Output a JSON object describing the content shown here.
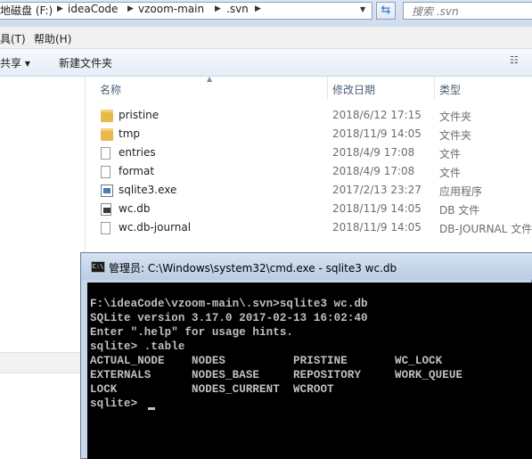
{
  "address_bar": {
    "crumbs": [
      "地磁盘 (F:)",
      "ideaCode",
      "vzoom-main",
      ".svn"
    ],
    "search_placeholder": "搜索 .svn"
  },
  "menu": {
    "items": [
      "具(T)",
      "帮助(H)"
    ]
  },
  "toolbar": {
    "share_label": "共享 ▾",
    "new_folder_label": "新建文件夹"
  },
  "columns": {
    "name": "名称",
    "modified": "修改日期",
    "type": "类型"
  },
  "files": [
    {
      "name": "pristine",
      "date": "2018/6/12 17:15",
      "type": "文件夹",
      "icon": "folder-icon"
    },
    {
      "name": "tmp",
      "date": "2018/11/9 14:05",
      "type": "文件夹",
      "icon": "folder-icon"
    },
    {
      "name": "entries",
      "date": "2018/4/9 17:08",
      "type": "文件",
      "icon": "file-icon"
    },
    {
      "name": "format",
      "date": "2018/4/9 17:08",
      "type": "文件",
      "icon": "file-icon"
    },
    {
      "name": "sqlite3.exe",
      "date": "2017/2/13 23:27",
      "type": "应用程序",
      "icon": "exe-icon"
    },
    {
      "name": "wc.db",
      "date": "2018/11/9 14:05",
      "type": "DB 文件",
      "icon": "db-file-icon"
    },
    {
      "name": "wc.db-journal",
      "date": "2018/11/9 14:05",
      "type": "DB-JOURNAL 文件",
      "icon": "file-icon"
    }
  ],
  "cmd": {
    "title": "管理员: C:\\Windows\\system32\\cmd.exe - sqlite3  wc.db",
    "lines": [
      "F:\\ideaCode\\vzoom-main\\.svn>sqlite3 wc.db",
      "SQLite version 3.17.0 2017-02-13 16:02:40",
      "Enter \".help\" for usage hints.",
      "sqlite> .table",
      "ACTUAL_NODE    NODES          PRISTINE       WC_LOCK",
      "EXTERNALS      NODES_BASE     REPOSITORY     WORK_QUEUE",
      "LOCK           NODES_CURRENT  WCROOT",
      "sqlite> "
    ]
  }
}
